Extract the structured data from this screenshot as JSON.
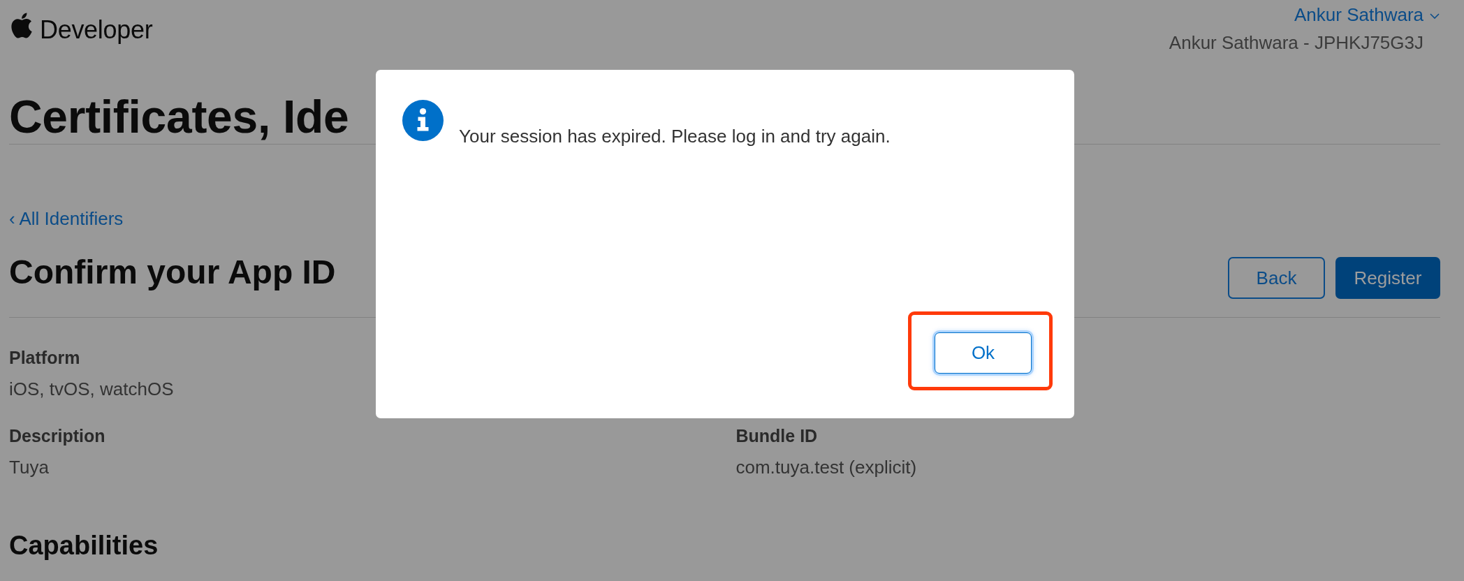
{
  "header": {
    "brand": "Developer",
    "account": {
      "name": "Ankur Sathwara",
      "team": "Ankur Sathwara - JPHKJ75G3J"
    }
  },
  "page": {
    "title": "Certificates, Ide",
    "back_link": "‹ All Identifiers",
    "heading": "Confirm your App ID",
    "actions": [
      {
        "label": "Back",
        "kind": "secondary"
      },
      {
        "label": "Register",
        "kind": "primary"
      }
    ],
    "details": [
      {
        "fields": [
          {
            "label": "Platform",
            "value": "iOS, tvOS, watchOS"
          }
        ]
      },
      {
        "fields": [
          {
            "label": "Description",
            "value": "Tuya"
          },
          {
            "label": "Bundle ID",
            "value": "com.tuya.test (explicit)"
          }
        ]
      }
    ],
    "section_heading": "Capabilities"
  },
  "dialog": {
    "message": "Your session has expired. Please log in and try again.",
    "buttons": [
      {
        "label": "Ok",
        "focused": true,
        "highlighted": true
      }
    ]
  }
}
